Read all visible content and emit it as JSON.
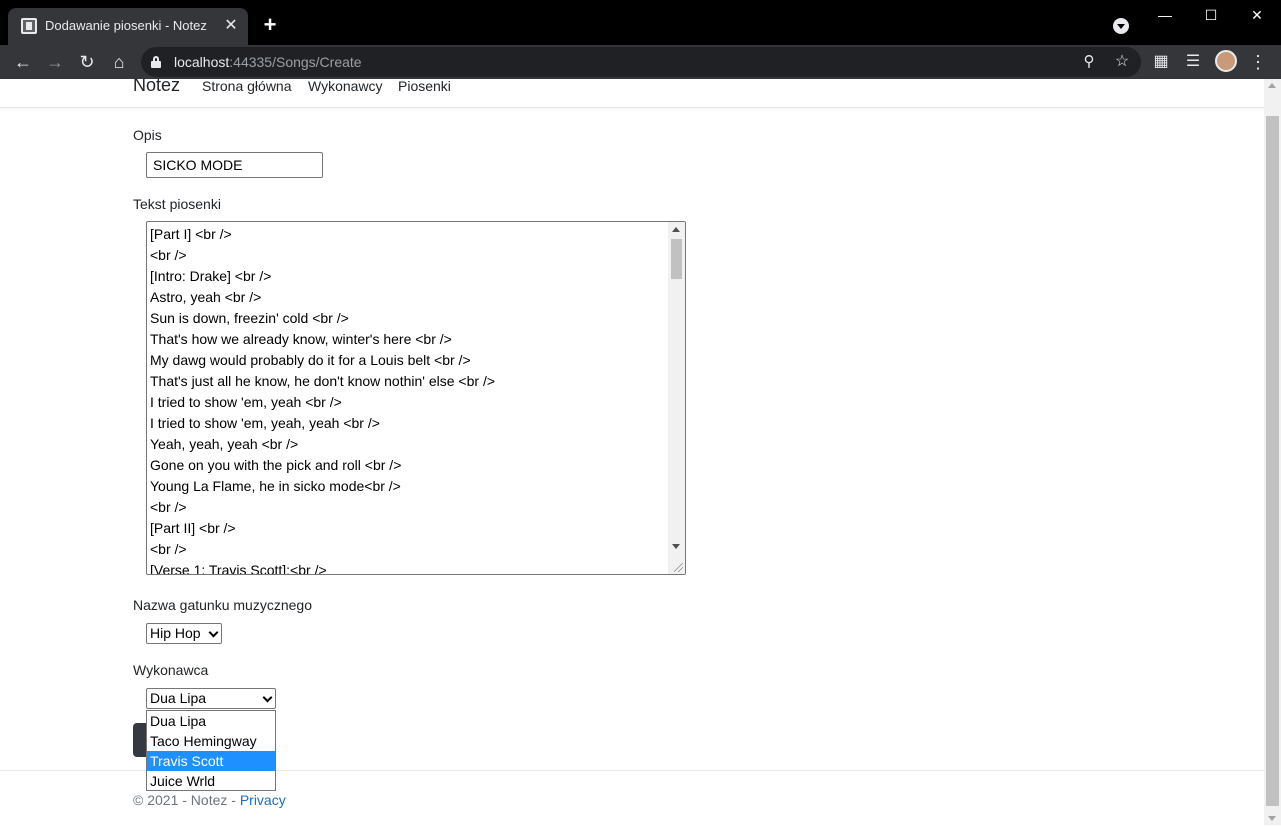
{
  "browser": {
    "tab_title": "Dodawanie piosenki - Notez",
    "tab_close": "✕",
    "new_tab": "+",
    "url_host": "localhost",
    "url_rest": ":44335/Songs/Create",
    "window_controls": {
      "minimize": "—",
      "maximize": "☐",
      "close": "✕"
    }
  },
  "navbar": {
    "brand": "Notez",
    "links": [
      "Strona główna",
      "Wykonawcy",
      "Piosenki"
    ]
  },
  "form": {
    "opis_label": "Opis",
    "opis_value": "SICKO MODE",
    "tekst_label": "Tekst piosenki",
    "tekst_lines": [
      "[Part I] <br />",
      "<br />",
      "[Intro: Drake] <br />",
      "Astro, yeah <br />",
      "Sun is down, freezin' cold <br />",
      "That's how we already know, winter's here <br />",
      "My dawg would probably do it for a Louis belt <br />",
      "That's just all he know, he don't know nothin' else <br />",
      "I tried to show 'em, yeah <br />",
      "I tried to show 'em, yeah, yeah <br />",
      "Yeah, yeah, yeah <br />",
      "Gone on you with the pick and roll <br />",
      "Young La Flame, he in sicko mode<br />",
      "<br />",
      "[Part II] <br />",
      "<br />",
      "[Verse 1: Travis Scott]:<br />"
    ],
    "gatunek_label": "Nazwa gatunku muzycznego",
    "gatunek_value": "Hip Hop",
    "wykonawca_label": "Wykonawca",
    "wykonawca_value": "Dua Lipa",
    "wykonawca_options": [
      "Dua Lipa",
      "Taco Hemingway",
      "Travis Scott",
      "Juice Wrld"
    ],
    "wykonawca_highlighted": "Travis Scott"
  },
  "footer": {
    "text": "© 2021 - Notez - ",
    "link": "Privacy"
  }
}
